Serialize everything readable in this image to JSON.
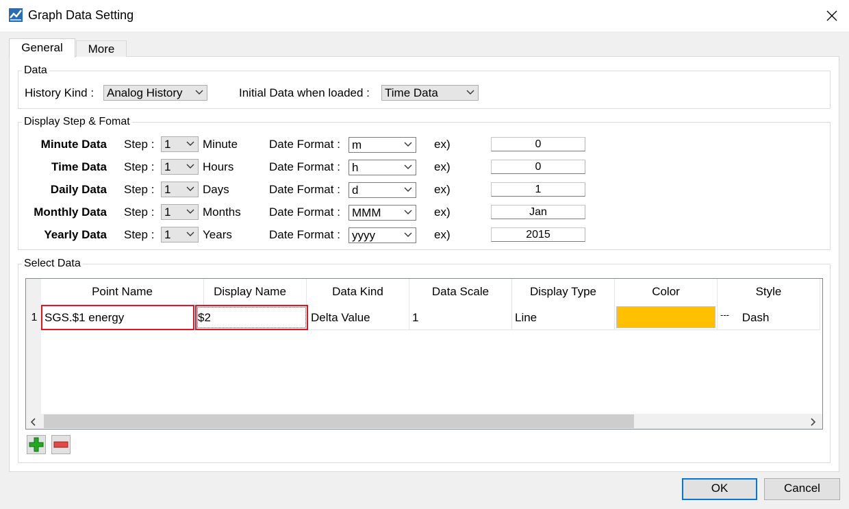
{
  "window": {
    "title": "Graph Data Setting"
  },
  "tabs": [
    {
      "label": "General"
    },
    {
      "label": "More"
    }
  ],
  "data_group": {
    "title": "Data",
    "history_kind_label": "History Kind :",
    "history_kind_value": "Analog History",
    "initial_data_label": "Initial Data when loaded :",
    "initial_data_value": "Time Data"
  },
  "display_group": {
    "title": "Display Step & Fomat",
    "step_label": "Step :",
    "date_format_label": "Date Format :",
    "ex_label": "ex)",
    "rows": [
      {
        "name": "Minute Data",
        "step": "1",
        "unit": "Minute",
        "format": "m",
        "example": "0"
      },
      {
        "name": "Time Data",
        "step": "1",
        "unit": "Hours",
        "format": "h",
        "example": "0"
      },
      {
        "name": "Daily Data",
        "step": "1",
        "unit": "Days",
        "format": "d",
        "example": "1"
      },
      {
        "name": "Monthly Data",
        "step": "1",
        "unit": "Months",
        "format": "MMM",
        "example": "Jan"
      },
      {
        "name": "Yearly Data",
        "step": "1",
        "unit": "Years",
        "format": "yyyy",
        "example": "2015"
      }
    ]
  },
  "select_group": {
    "title": "Select Data",
    "columns": [
      "Point Name",
      "Display Name",
      "Data Kind",
      "Data Scale",
      "Display Type",
      "Color",
      "Style"
    ],
    "rows": [
      {
        "index": "1",
        "point_name": "SGS.$1 energy",
        "display_name": "$2",
        "data_kind": "Delta Value",
        "data_scale": "1",
        "display_type": "Line",
        "color": "#ffc000",
        "style_glyph": "---",
        "style": "Dash"
      }
    ]
  },
  "buttons": {
    "ok": "OK",
    "cancel": "Cancel"
  },
  "icons": {
    "app": "graph-app-icon",
    "close": "close-icon",
    "add": "plus-icon",
    "remove": "minus-icon",
    "scroll_left": "chevron-left-icon",
    "scroll_right": "chevron-right-icon",
    "dropdown": "chevron-down-icon"
  },
  "colors": {
    "accent": "#0078d7",
    "selection": "#e81123",
    "add": "#22a822",
    "remove": "#e04848"
  }
}
